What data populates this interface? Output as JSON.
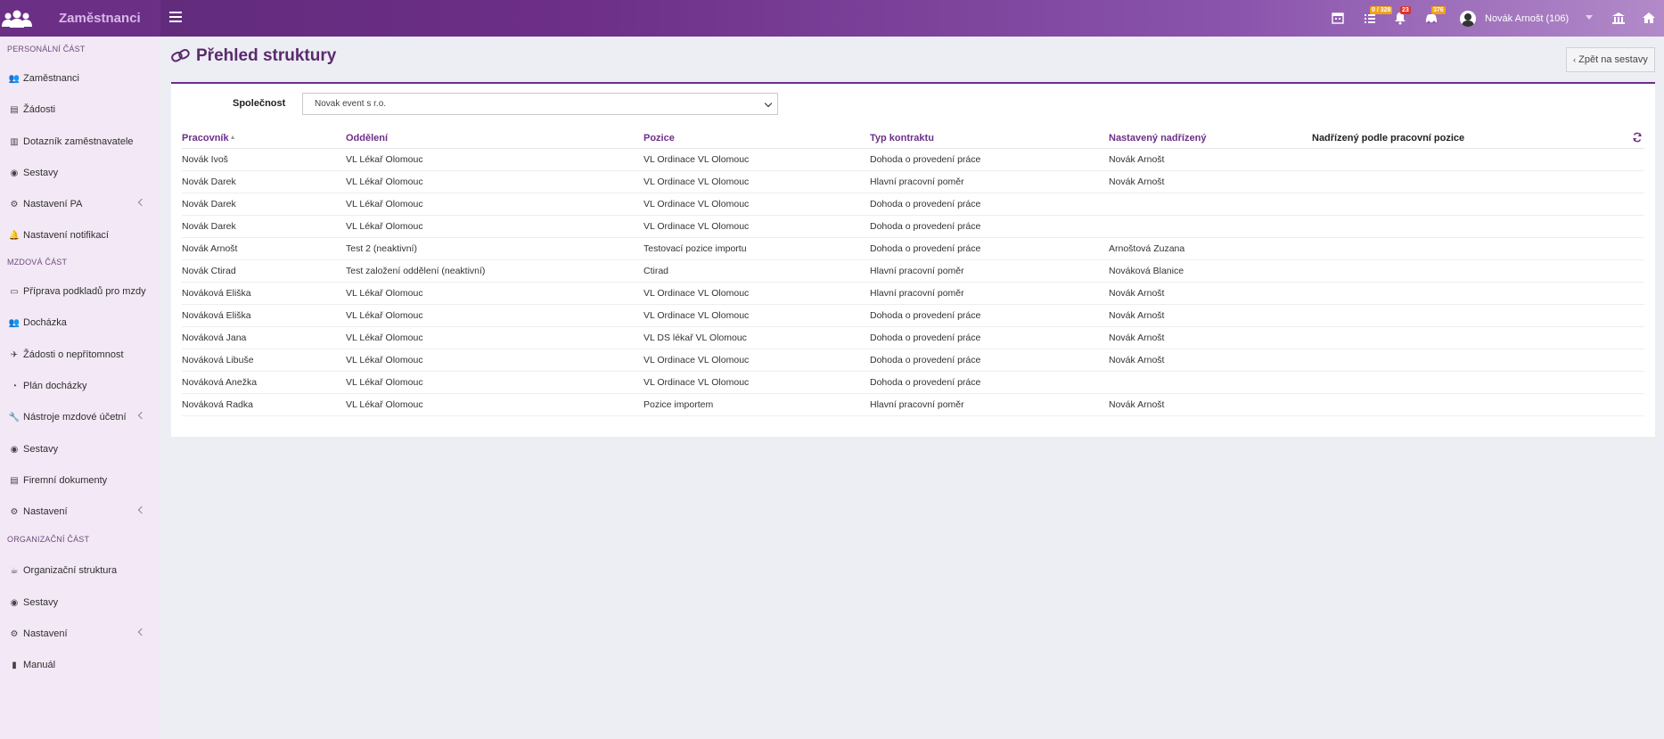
{
  "app": {
    "title": "Zaměstnanci"
  },
  "topbar": {
    "badges": [
      {
        "icon": "calendar-icon",
        "text": ""
      },
      {
        "icon": "tasks-icon",
        "text": "0 / 328",
        "color": "#f0a21e"
      },
      {
        "icon": "bell-icon",
        "text": "23",
        "color": "#e0342b"
      },
      {
        "icon": "car-icon",
        "text": "376",
        "color": "#f0a21e"
      }
    ],
    "user": "Novák Arnošt (106)"
  },
  "sidebar": {
    "sections": {
      "personal": "PERSONÁLNÍ ČÁST",
      "payroll": "MZDOVÁ ČÁST",
      "org": "ORGANIZAČNÍ ČÁST"
    },
    "items": [
      {
        "label": "Zaměstnanci",
        "icon": "users-icon",
        "glyph": "👥"
      },
      {
        "label": "Žádosti",
        "icon": "document-icon",
        "glyph": "▤"
      },
      {
        "label": "Dotazník zaměstnavatele",
        "icon": "building-icon",
        "glyph": "▥"
      },
      {
        "label": "Sestavy",
        "icon": "eye-icon",
        "glyph": "◉"
      },
      {
        "label": "Nastavení PA",
        "icon": "gears-icon",
        "glyph": "⚙"
      },
      {
        "label": "Nastavení notifikací",
        "icon": "bell-icon",
        "glyph": "🔔"
      },
      {
        "label": "Příprava podkladů pro mzdy",
        "icon": "money-icon",
        "glyph": "▭"
      },
      {
        "label": "Docházka",
        "icon": "users-icon",
        "glyph": "👥"
      },
      {
        "label": "Žádosti o nepřítomnost",
        "icon": "plane-icon",
        "glyph": "✈"
      },
      {
        "label": "Plán docházky",
        "icon": "clock-icon",
        "glyph": "◔"
      },
      {
        "label": "Nástroje mzdové účetní",
        "icon": "wrench-icon",
        "glyph": "🔧"
      },
      {
        "label": "Sestavy",
        "icon": "eye-icon",
        "glyph": "◉"
      },
      {
        "label": "Firemní dokumenty",
        "icon": "file-icon",
        "glyph": "▤"
      },
      {
        "label": "Nastavení",
        "icon": "gears-icon",
        "glyph": "⚙"
      },
      {
        "label": "Organizační struktura",
        "icon": "coffee-icon",
        "glyph": "☕"
      },
      {
        "label": "Sestavy",
        "icon": "eye-icon",
        "glyph": "◉"
      },
      {
        "label": "Nastavení",
        "icon": "gears-icon",
        "glyph": "⚙"
      },
      {
        "label": "Manuál",
        "icon": "book-icon",
        "glyph": "▮"
      }
    ]
  },
  "main": {
    "title": "Přehled struktury",
    "back_button": "Zpět na sestavy",
    "company_label": "Společnost",
    "company_value": "Novak event s r.o.",
    "columns": [
      "Pracovník",
      "Oddělení",
      "Pozice",
      "Typ kontraktu",
      "Nastavený nadřízený",
      "Nadřízený podle pracovní pozice"
    ],
    "rows": [
      [
        "Novák Ivoš",
        "VL Lékař Olomouc",
        "VL Ordinace VL Olomouc",
        "Dohoda o provedení práce",
        "Novák Arnošt",
        ""
      ],
      [
        "Novák Darek",
        "VL Lékař Olomouc",
        "VL Ordinace VL Olomouc",
        "Hlavní pracovní poměr",
        "Novák Arnošt",
        ""
      ],
      [
        "Novák Darek",
        "VL Lékař Olomouc",
        "VL Ordinace VL Olomouc",
        "Dohoda o provedení práce",
        "",
        ""
      ],
      [
        "Novák Darek",
        "VL Lékař Olomouc",
        "VL Ordinace VL Olomouc",
        "Dohoda o provedení práce",
        "",
        ""
      ],
      [
        "Novák Arnošt",
        "Test 2 (neaktivní)",
        "Testovací pozice importu",
        "Dohoda o provedení práce",
        "Arnoštová Zuzana",
        ""
      ],
      [
        "Novák Ctirad",
        "Test založení oddělení (neaktivní)",
        "Ctirad",
        "Hlavní pracovní poměr",
        "Nováková Blanice",
        ""
      ],
      [
        "Nováková Eliška",
        "VL Lékař Olomouc",
        "VL Ordinace VL Olomouc",
        "Hlavní pracovní poměr",
        "Novák Arnošt",
        ""
      ],
      [
        "Nováková Eliška",
        "VL Lékař Olomouc",
        "VL Ordinace VL Olomouc",
        "Dohoda o provedení práce",
        "Novák Arnošt",
        ""
      ],
      [
        "Nováková Jana",
        "VL Lékař Olomouc",
        "VL DS lékař VL Olomouc",
        "Dohoda o provedení práce",
        "Novák Arnošt",
        ""
      ],
      [
        "Nováková Libuše",
        "VL Lékař Olomouc",
        "VL Ordinace VL Olomouc",
        "Dohoda o provedení práce",
        "Novák Arnošt",
        ""
      ],
      [
        "Nováková Anežka",
        "VL Lékař Olomouc",
        "VL Ordinace VL Olomouc",
        "Dohoda o provedení práce",
        "",
        ""
      ],
      [
        "Nováková Radka",
        "VL Lékař Olomouc",
        "Pozice importem",
        "Hlavní pracovní poměr",
        "Novák Arnošt",
        ""
      ]
    ]
  }
}
